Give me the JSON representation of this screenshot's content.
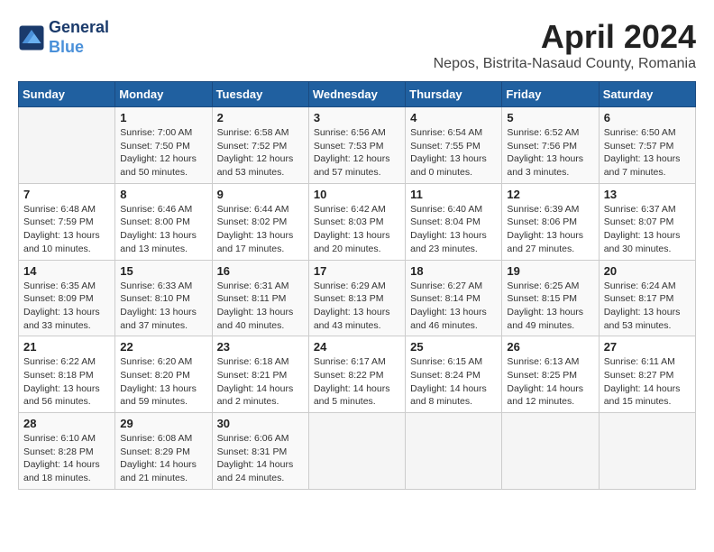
{
  "header": {
    "logo_line1": "General",
    "logo_line2": "Blue",
    "month": "April 2024",
    "location": "Nepos, Bistrita-Nasaud County, Romania"
  },
  "weekdays": [
    "Sunday",
    "Monday",
    "Tuesday",
    "Wednesday",
    "Thursday",
    "Friday",
    "Saturday"
  ],
  "weeks": [
    [
      {
        "day": "",
        "content": ""
      },
      {
        "day": "1",
        "content": "Sunrise: 7:00 AM\nSunset: 7:50 PM\nDaylight: 12 hours\nand 50 minutes."
      },
      {
        "day": "2",
        "content": "Sunrise: 6:58 AM\nSunset: 7:52 PM\nDaylight: 12 hours\nand 53 minutes."
      },
      {
        "day": "3",
        "content": "Sunrise: 6:56 AM\nSunset: 7:53 PM\nDaylight: 12 hours\nand 57 minutes."
      },
      {
        "day": "4",
        "content": "Sunrise: 6:54 AM\nSunset: 7:55 PM\nDaylight: 13 hours\nand 0 minutes."
      },
      {
        "day": "5",
        "content": "Sunrise: 6:52 AM\nSunset: 7:56 PM\nDaylight: 13 hours\nand 3 minutes."
      },
      {
        "day": "6",
        "content": "Sunrise: 6:50 AM\nSunset: 7:57 PM\nDaylight: 13 hours\nand 7 minutes."
      }
    ],
    [
      {
        "day": "7",
        "content": "Sunrise: 6:48 AM\nSunset: 7:59 PM\nDaylight: 13 hours\nand 10 minutes."
      },
      {
        "day": "8",
        "content": "Sunrise: 6:46 AM\nSunset: 8:00 PM\nDaylight: 13 hours\nand 13 minutes."
      },
      {
        "day": "9",
        "content": "Sunrise: 6:44 AM\nSunset: 8:02 PM\nDaylight: 13 hours\nand 17 minutes."
      },
      {
        "day": "10",
        "content": "Sunrise: 6:42 AM\nSunset: 8:03 PM\nDaylight: 13 hours\nand 20 minutes."
      },
      {
        "day": "11",
        "content": "Sunrise: 6:40 AM\nSunset: 8:04 PM\nDaylight: 13 hours\nand 23 minutes."
      },
      {
        "day": "12",
        "content": "Sunrise: 6:39 AM\nSunset: 8:06 PM\nDaylight: 13 hours\nand 27 minutes."
      },
      {
        "day": "13",
        "content": "Sunrise: 6:37 AM\nSunset: 8:07 PM\nDaylight: 13 hours\nand 30 minutes."
      }
    ],
    [
      {
        "day": "14",
        "content": "Sunrise: 6:35 AM\nSunset: 8:09 PM\nDaylight: 13 hours\nand 33 minutes."
      },
      {
        "day": "15",
        "content": "Sunrise: 6:33 AM\nSunset: 8:10 PM\nDaylight: 13 hours\nand 37 minutes."
      },
      {
        "day": "16",
        "content": "Sunrise: 6:31 AM\nSunset: 8:11 PM\nDaylight: 13 hours\nand 40 minutes."
      },
      {
        "day": "17",
        "content": "Sunrise: 6:29 AM\nSunset: 8:13 PM\nDaylight: 13 hours\nand 43 minutes."
      },
      {
        "day": "18",
        "content": "Sunrise: 6:27 AM\nSunset: 8:14 PM\nDaylight: 13 hours\nand 46 minutes."
      },
      {
        "day": "19",
        "content": "Sunrise: 6:25 AM\nSunset: 8:15 PM\nDaylight: 13 hours\nand 49 minutes."
      },
      {
        "day": "20",
        "content": "Sunrise: 6:24 AM\nSunset: 8:17 PM\nDaylight: 13 hours\nand 53 minutes."
      }
    ],
    [
      {
        "day": "21",
        "content": "Sunrise: 6:22 AM\nSunset: 8:18 PM\nDaylight: 13 hours\nand 56 minutes."
      },
      {
        "day": "22",
        "content": "Sunrise: 6:20 AM\nSunset: 8:20 PM\nDaylight: 13 hours\nand 59 minutes."
      },
      {
        "day": "23",
        "content": "Sunrise: 6:18 AM\nSunset: 8:21 PM\nDaylight: 14 hours\nand 2 minutes."
      },
      {
        "day": "24",
        "content": "Sunrise: 6:17 AM\nSunset: 8:22 PM\nDaylight: 14 hours\nand 5 minutes."
      },
      {
        "day": "25",
        "content": "Sunrise: 6:15 AM\nSunset: 8:24 PM\nDaylight: 14 hours\nand 8 minutes."
      },
      {
        "day": "26",
        "content": "Sunrise: 6:13 AM\nSunset: 8:25 PM\nDaylight: 14 hours\nand 12 minutes."
      },
      {
        "day": "27",
        "content": "Sunrise: 6:11 AM\nSunset: 8:27 PM\nDaylight: 14 hours\nand 15 minutes."
      }
    ],
    [
      {
        "day": "28",
        "content": "Sunrise: 6:10 AM\nSunset: 8:28 PM\nDaylight: 14 hours\nand 18 minutes."
      },
      {
        "day": "29",
        "content": "Sunrise: 6:08 AM\nSunset: 8:29 PM\nDaylight: 14 hours\nand 21 minutes."
      },
      {
        "day": "30",
        "content": "Sunrise: 6:06 AM\nSunset: 8:31 PM\nDaylight: 14 hours\nand 24 minutes."
      },
      {
        "day": "",
        "content": ""
      },
      {
        "day": "",
        "content": ""
      },
      {
        "day": "",
        "content": ""
      },
      {
        "day": "",
        "content": ""
      }
    ]
  ]
}
